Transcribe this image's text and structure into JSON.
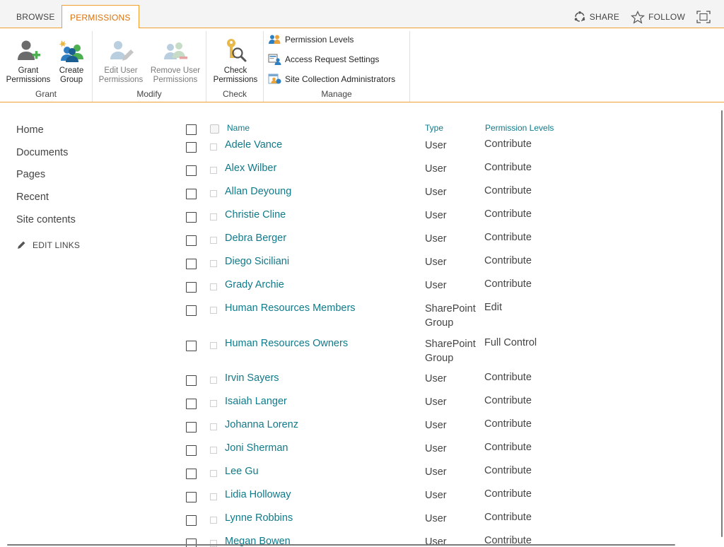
{
  "tabs": {
    "browse": "BROWSE",
    "permissions": "PERMISSIONS"
  },
  "top_actions": {
    "share": "SHARE",
    "follow": "FOLLOW"
  },
  "ribbon": {
    "grant": {
      "label": "Grant",
      "grant_permissions": [
        "Grant",
        "Permissions"
      ],
      "create_group": [
        "Create",
        "Group"
      ]
    },
    "modify": {
      "label": "Modify",
      "edit_user_permissions": [
        "Edit User",
        "Permissions"
      ],
      "remove_user_permissions": [
        "Remove User",
        "Permissions"
      ]
    },
    "check": {
      "label": "Check",
      "check_permissions": [
        "Check",
        "Permissions"
      ]
    },
    "manage": {
      "label": "Manage",
      "permission_levels": "Permission Levels",
      "access_request_settings": "Access Request Settings",
      "site_collection_administrators": "Site Collection Administrators"
    }
  },
  "left_nav": {
    "items": [
      "Home",
      "Documents",
      "Pages",
      "Recent",
      "Site contents"
    ],
    "edit_links": "EDIT LINKS"
  },
  "list": {
    "headers": {
      "name": "Name",
      "type": "Type",
      "permission_levels": "Permission Levels"
    },
    "rows": [
      {
        "name": "Adele Vance",
        "type": "User",
        "permission": "Contribute"
      },
      {
        "name": "Alex Wilber",
        "type": "User",
        "permission": "Contribute"
      },
      {
        "name": "Allan Deyoung",
        "type": "User",
        "permission": "Contribute"
      },
      {
        "name": "Christie Cline",
        "type": "User",
        "permission": "Contribute"
      },
      {
        "name": "Debra Berger",
        "type": "User",
        "permission": "Contribute"
      },
      {
        "name": "Diego Siciliani",
        "type": "User",
        "permission": "Contribute"
      },
      {
        "name": "Grady Archie",
        "type": "User",
        "permission": "Contribute"
      },
      {
        "name": "Human Resources Members",
        "type": "SharePoint Group",
        "permission": "Edit"
      },
      {
        "name": "Human Resources Owners",
        "type": "SharePoint Group",
        "permission": "Full Control"
      },
      {
        "name": "Irvin Sayers",
        "type": "User",
        "permission": "Contribute"
      },
      {
        "name": "Isaiah Langer",
        "type": "User",
        "permission": "Contribute"
      },
      {
        "name": "Johanna Lorenz",
        "type": "User",
        "permission": "Contribute"
      },
      {
        "name": "Joni Sherman",
        "type": "User",
        "permission": "Contribute"
      },
      {
        "name": "Lee Gu",
        "type": "User",
        "permission": "Contribute"
      },
      {
        "name": "Lidia Holloway",
        "type": "User",
        "permission": "Contribute"
      },
      {
        "name": "Lynne Robbins",
        "type": "User",
        "permission": "Contribute"
      },
      {
        "name": "Megan Bowen",
        "type": "User",
        "permission": "Contribute"
      }
    ]
  },
  "colors": {
    "accent": "#f0a030",
    "active_tab_text": "#d9730d",
    "link": "#0f7a8a",
    "text": "#444444"
  },
  "icons": {
    "grant_permissions": "user-add-icon",
    "create_group": "group-create-icon",
    "edit_user_permissions": "user-edit-icon",
    "remove_user_permissions": "user-remove-icon",
    "check_permissions": "key-magnifier-icon",
    "permission_levels": "people-icon",
    "access_request_settings": "access-request-icon",
    "site_collection_administrators": "admin-icon",
    "share": "share-icon",
    "follow": "star-icon",
    "focus": "focus-frame-icon",
    "edit_links": "pencil-icon"
  }
}
